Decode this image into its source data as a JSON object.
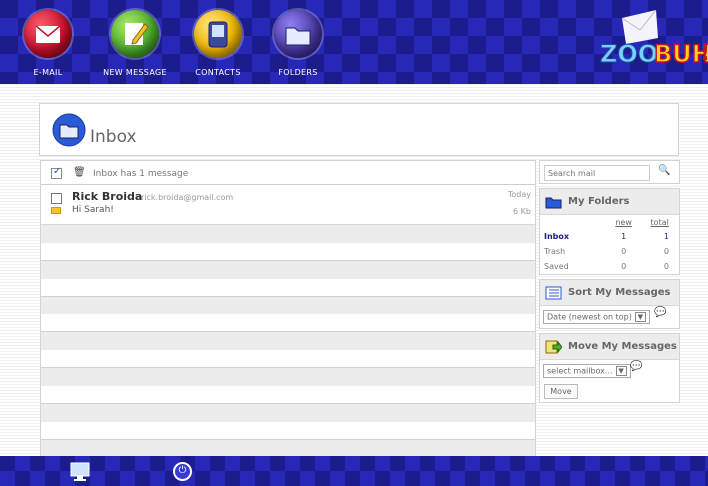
{
  "nav": {
    "items": [
      {
        "label": "E-MAIL",
        "icon": "envelope-icon",
        "color": "#c8102e"
      },
      {
        "label": "NEW MESSAGE",
        "icon": "pencil-paper-icon",
        "color": "#4fae2e"
      },
      {
        "label": "CONTACTS",
        "icon": "pda-icon",
        "color": "#f1b800"
      },
      {
        "label": "FOLDERS",
        "icon": "folder-icon",
        "color": "#4b3aa8"
      }
    ]
  },
  "logo": {
    "icon": "zoobuh-logo-icon"
  },
  "page": {
    "title": "Inbox",
    "icon": "inbox-folder-icon"
  },
  "toolbar": {
    "count_text": "Inbox has 1 message",
    "trash_icon": "trash-icon"
  },
  "messages": [
    {
      "sender": "Rick Broida",
      "email": "rick.broida@gmail.com",
      "date": "Today",
      "subject": "Hi Sarah!",
      "size": "6 Kb"
    }
  ],
  "search": {
    "placeholder": "Search mail",
    "icon": "search-icon"
  },
  "folders": {
    "title": "My Folders",
    "col_new": "new",
    "col_total": "total",
    "rows": [
      {
        "name": "Inbox",
        "new": "1",
        "total": "1"
      },
      {
        "name": "Trash",
        "new": "0",
        "total": "0"
      },
      {
        "name": "Saved",
        "new": "0",
        "total": "0"
      }
    ]
  },
  "sort": {
    "title": "Sort My Messages",
    "selected": "Date (newest on top)"
  },
  "move": {
    "title": "Move My Messages",
    "selected": "select mailbox...",
    "button": "Move"
  },
  "footer": {
    "icons": [
      "monitor-icon",
      "power-icon"
    ]
  }
}
